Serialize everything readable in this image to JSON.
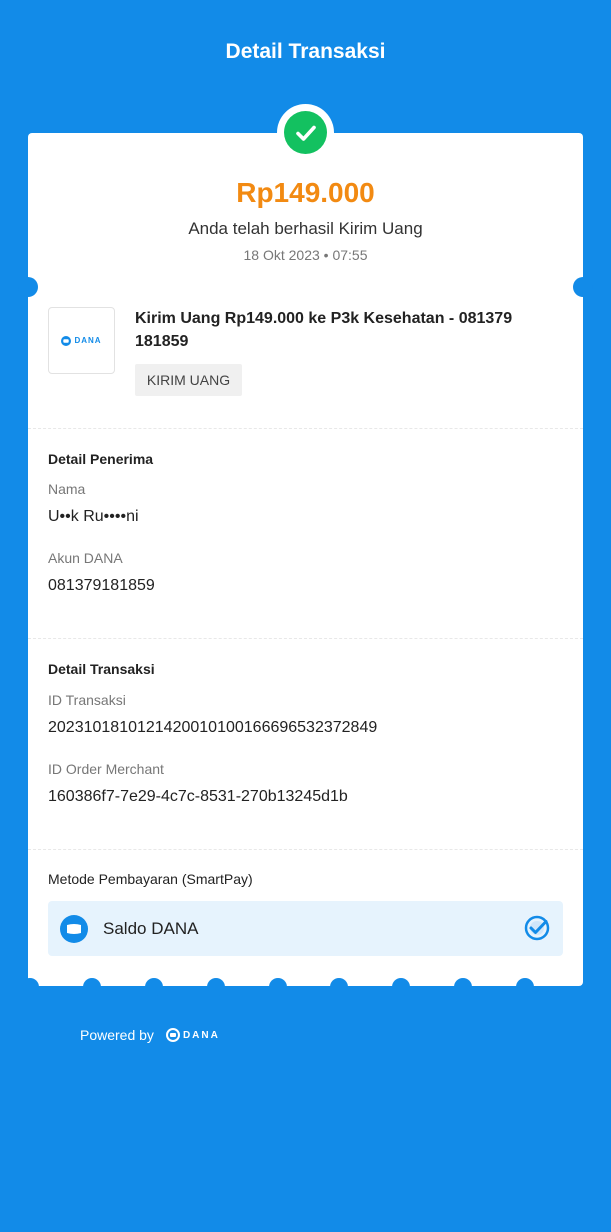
{
  "header": {
    "title": "Detail Transaksi"
  },
  "summary": {
    "amount": "Rp149.000",
    "status": "Anda telah berhasil Kirim Uang",
    "datetime": "18 Okt 2023 • 07:55",
    "status_icon": "check-circle-icon"
  },
  "transaction": {
    "logo_text": "DANA",
    "title": "Kirim Uang Rp149.000 ke P3k Kesehatan - 081379 181859",
    "tag": "KIRIM UANG"
  },
  "recipient": {
    "section_title": "Detail Penerima",
    "name_label": "Nama",
    "name_value": "U••k Ru••••ni",
    "account_label": "Akun DANA",
    "account_value": "081379181859"
  },
  "details": {
    "section_title": "Detail Transaksi",
    "id_label": "ID Transaksi",
    "id_value": "20231018101214200101001666965323728​49",
    "order_label": "ID Order Merchant",
    "order_value": "160386f7-7e29-4c7c-8531-270b13245d1b"
  },
  "payment": {
    "section_title": "Metode Pembayaran (SmartPay)",
    "method": "Saldo DANA",
    "icon": "dana-wallet-icon",
    "selected_icon": "selected-check-icon"
  },
  "footer": {
    "powered_by": "Powered by",
    "logo_text": "DANA"
  },
  "colors": {
    "brand_blue": "#128be8",
    "amount_orange": "#f28a12",
    "success_green": "#13c160"
  }
}
